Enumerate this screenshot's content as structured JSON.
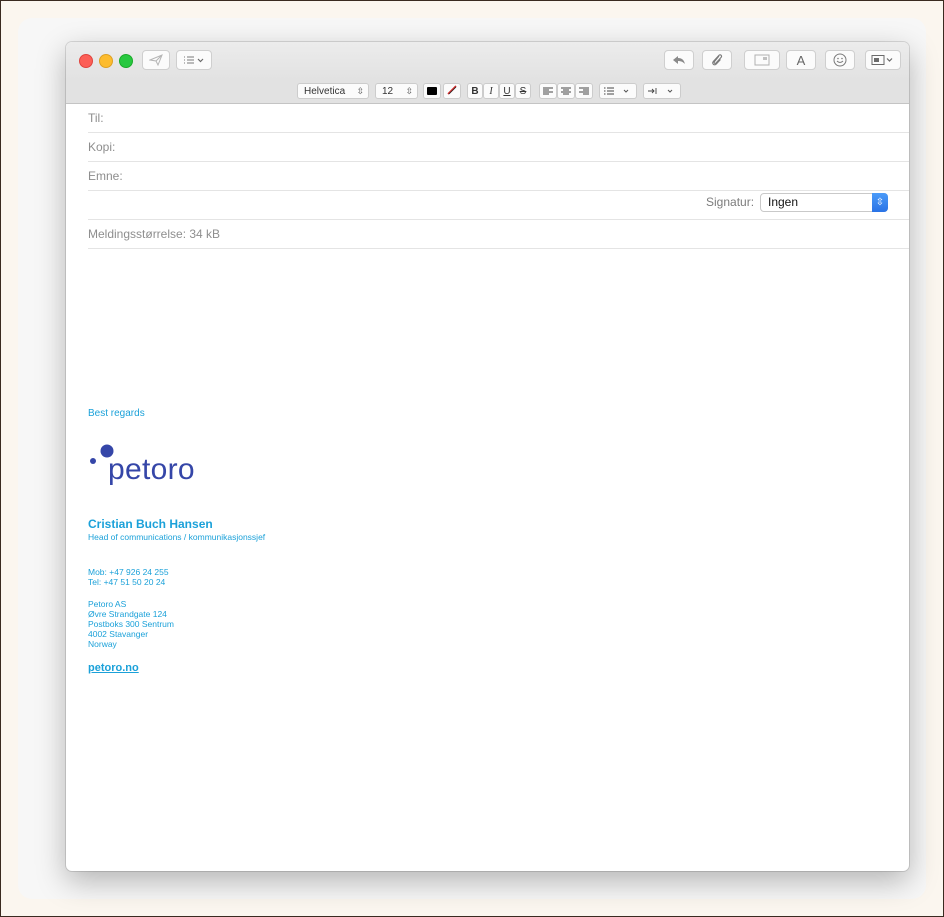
{
  "compose": {
    "to_label": "Til:",
    "cc_label": "Kopi:",
    "subject_label": "Emne:",
    "signature_label": "Signatur:",
    "signature_value": "Ingen",
    "message_size": "Meldingsstørrelse: 34 kB"
  },
  "format_bar": {
    "font": "Helvetica",
    "size": "12",
    "bold": "B",
    "italic": "I",
    "underline": "U",
    "strike": "S"
  },
  "toolbar": {
    "format_text_button": "A"
  },
  "signature": {
    "greeting": "Best regards",
    "logo_text": "petoro",
    "name": "Cristian Buch Hansen",
    "title": "Head of communications / kommunikasjonssjef",
    "mobile": "Mob: +47 926 24 255",
    "tel": "Tel: +47 51 50 20 24",
    "address": [
      "Petoro AS",
      "Øvre Strandgate 124",
      "Postboks 300 Sentrum",
      "4002 Stavanger",
      "Norway"
    ],
    "website": "petoro.no"
  },
  "colors": {
    "accent_blue": "#1ba1d9",
    "logo_navy": "#3546a8",
    "close": "#fc5f57",
    "minimize": "#fdbc2e",
    "zoom": "#28c840"
  },
  "icons": {
    "send": "paper-plane-icon",
    "header_fields": "list-icon",
    "reply": "reply-arrow-icon",
    "attach": "paperclip-icon",
    "photo_browser": "photo-browser-icon",
    "emoji": "emoji-icon",
    "markup": "markup-icon"
  }
}
